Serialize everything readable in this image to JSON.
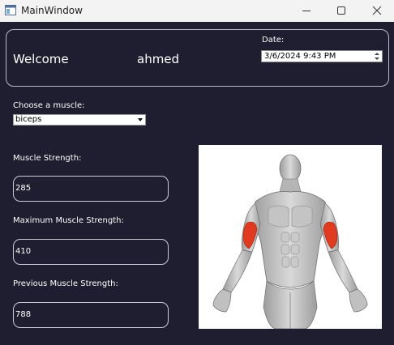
{
  "window": {
    "title": "MainWindow"
  },
  "header": {
    "welcome": "Welcome",
    "username": "ahmed",
    "date_label": "Date:",
    "date_value": "3/6/2024 9:43 PM"
  },
  "muscle": {
    "label": "Choose a muscle:",
    "selected": "biceps"
  },
  "fields": [
    {
      "label": "Muscle Strength:",
      "value": "285"
    },
    {
      "label": "Maximum Muscle Strength:",
      "value": "410"
    },
    {
      "label": "Previous Muscle Strength:",
      "value": "788"
    }
  ],
  "image": {
    "subject": "anatomy-figure-biceps-highlighted",
    "highlight_color": "#e23a1e"
  },
  "colors": {
    "background": "#1f1e30",
    "titlebar": "#f3f3f3",
    "border": "#c9cbd6"
  }
}
